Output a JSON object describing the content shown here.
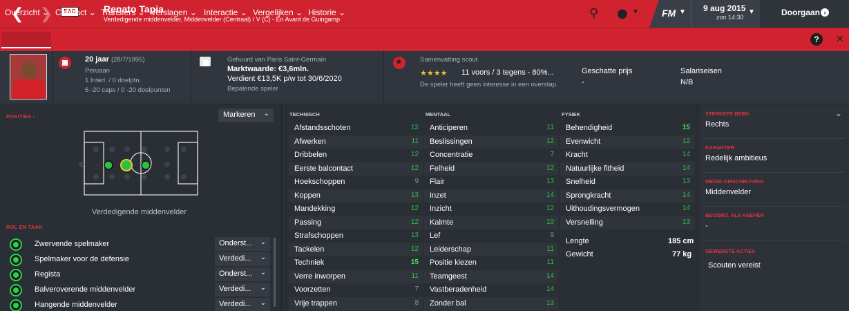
{
  "header": {
    "player_name": "Renato Tapia",
    "player_sub": "Verdedigende middenvelder, Middenvelder (Centraal) / V (C) - En Avant de Guingamp",
    "club_badge": "EAG",
    "fm_logo": "FM",
    "date": "9 aug 2015",
    "time": "zon 14:30",
    "continue_label": "Doorgaan",
    "icons": [
      "back-arrow-icon",
      "forward-arrow-icon",
      "search-icon",
      "globe-icon",
      "chevron-down-icon",
      "help-icon",
      "close-icon"
    ]
  },
  "tabs": [
    {
      "label": "Overzicht"
    },
    {
      "label": "Contract"
    },
    {
      "label": "Transfers"
    },
    {
      "label": "Verslagen"
    },
    {
      "label": "Interactie"
    },
    {
      "label": "Vergelijken"
    },
    {
      "label": "Historie"
    }
  ],
  "info": {
    "age": "20 jaar",
    "dob": "(28/7/1995)",
    "nationality": "Peruaan",
    "intl": "1 Interl. / 0 doelptn.",
    "caps": "6 -20 caps / 0 -20 doelpunten",
    "loan_from": "Gehuurd van Paris Saint-Germain",
    "market_value": "Marktwaarde: €3,6mln.",
    "wage": "Verdient €13,5K p/w tot 30/6/2020",
    "role_status": "Bepalende speler",
    "scout_title": "Samenvatting scout",
    "scout_stars": 4,
    "scout_summary": "11 voors / 3 tegens - 80%...",
    "scout_note": "De speler heeft geen interesse in een overstap.",
    "price_label": "Geschatte prijs",
    "price_value": "-",
    "salary_label": "Salariseisen",
    "salary_value": "N/B"
  },
  "left": {
    "positions_label": "POSITIES ›",
    "dropdown": "Markeren",
    "position_caption": "Verdedigende middenvelder",
    "roles_label": "ROL EN TAAK",
    "roles": [
      {
        "name": "Zwervende spelmaker",
        "duty": "Onderst..."
      },
      {
        "name": "Spelmaker voor de defensie",
        "duty": "Verdedi..."
      },
      {
        "name": "Regista",
        "duty": "Onderst..."
      },
      {
        "name": "Balveroverende middenvelder",
        "duty": "Verdedi..."
      },
      {
        "name": "Hangende middenvelder",
        "duty": "Verdedi..."
      }
    ]
  },
  "attributes": {
    "technical_label": "TECHNISCH",
    "mental_label": "MENTAAL",
    "physical_label": "FYSIEK",
    "technical": [
      {
        "name": "Afstandsschoten",
        "value": "12"
      },
      {
        "name": "Afwerken",
        "value": "11"
      },
      {
        "name": "Dribbelen",
        "value": "12"
      },
      {
        "name": "Eerste balcontact",
        "value": "12"
      },
      {
        "name": "Hoekschoppen",
        "value": "9"
      },
      {
        "name": "Koppen",
        "value": "13"
      },
      {
        "name": "Mandekking",
        "value": "12"
      },
      {
        "name": "Passing",
        "value": "12"
      },
      {
        "name": "Strafschoppen",
        "value": "13"
      },
      {
        "name": "Tackelen",
        "value": "12"
      },
      {
        "name": "Techniek",
        "value": "15"
      },
      {
        "name": "Verre inworpen",
        "value": "11"
      },
      {
        "name": "Voorzetten",
        "value": "7"
      },
      {
        "name": "Vrije trappen",
        "value": "8"
      }
    ],
    "mental": [
      {
        "name": "Anticiperen",
        "value": "11"
      },
      {
        "name": "Beslissingen",
        "value": "12"
      },
      {
        "name": "Concentratie",
        "value": "7"
      },
      {
        "name": "Felheid",
        "value": "12"
      },
      {
        "name": "Flair",
        "value": "13"
      },
      {
        "name": "Inzet",
        "value": "14"
      },
      {
        "name": "Inzicht",
        "value": "12"
      },
      {
        "name": "Kalmte",
        "value": "10"
      },
      {
        "name": "Lef",
        "value": "9"
      },
      {
        "name": "Leiderschap",
        "value": "11"
      },
      {
        "name": "Positie kiezen",
        "value": "11"
      },
      {
        "name": "Teamgeest",
        "value": "14"
      },
      {
        "name": "Vastberadenheid",
        "value": "14"
      },
      {
        "name": "Zonder bal",
        "value": "13"
      }
    ],
    "physical": [
      {
        "name": "Behendigheid",
        "value": "15"
      },
      {
        "name": "Evenwicht",
        "value": "12"
      },
      {
        "name": "Kracht",
        "value": "14"
      },
      {
        "name": "Natuurlijke fitheid",
        "value": "14"
      },
      {
        "name": "Snelheid",
        "value": "13"
      },
      {
        "name": "Sprongkracht",
        "value": "14"
      },
      {
        "name": "Uithoudingsvermogen",
        "value": "14"
      },
      {
        "name": "Versnelling",
        "value": "13"
      }
    ],
    "length_label": "Lengte",
    "length_value": "185 cm",
    "weight_label": "Gewicht",
    "weight_value": "77 kg"
  },
  "right": {
    "foot_label": "STERKSTE BEEN",
    "foot_value": "Rechts",
    "character_label": "KARAKTER",
    "character_value": "Redelijk ambitieus",
    "media_label": "MEDIA-OMSCHRIJVING",
    "media_value": "Middenvelder",
    "keeper_label": "BEOORD. ALS KEEPER",
    "keeper_value": "-",
    "actions_label": "GEWENSTE ACTIES",
    "actions_value": "Scouten vereist"
  },
  "colors": {
    "accent": "#d0222f",
    "attr_green": "#2ec043",
    "attr_bright": "#48e05a",
    "attr_grey": "#8a8f96",
    "stars": "#f4c430"
  }
}
